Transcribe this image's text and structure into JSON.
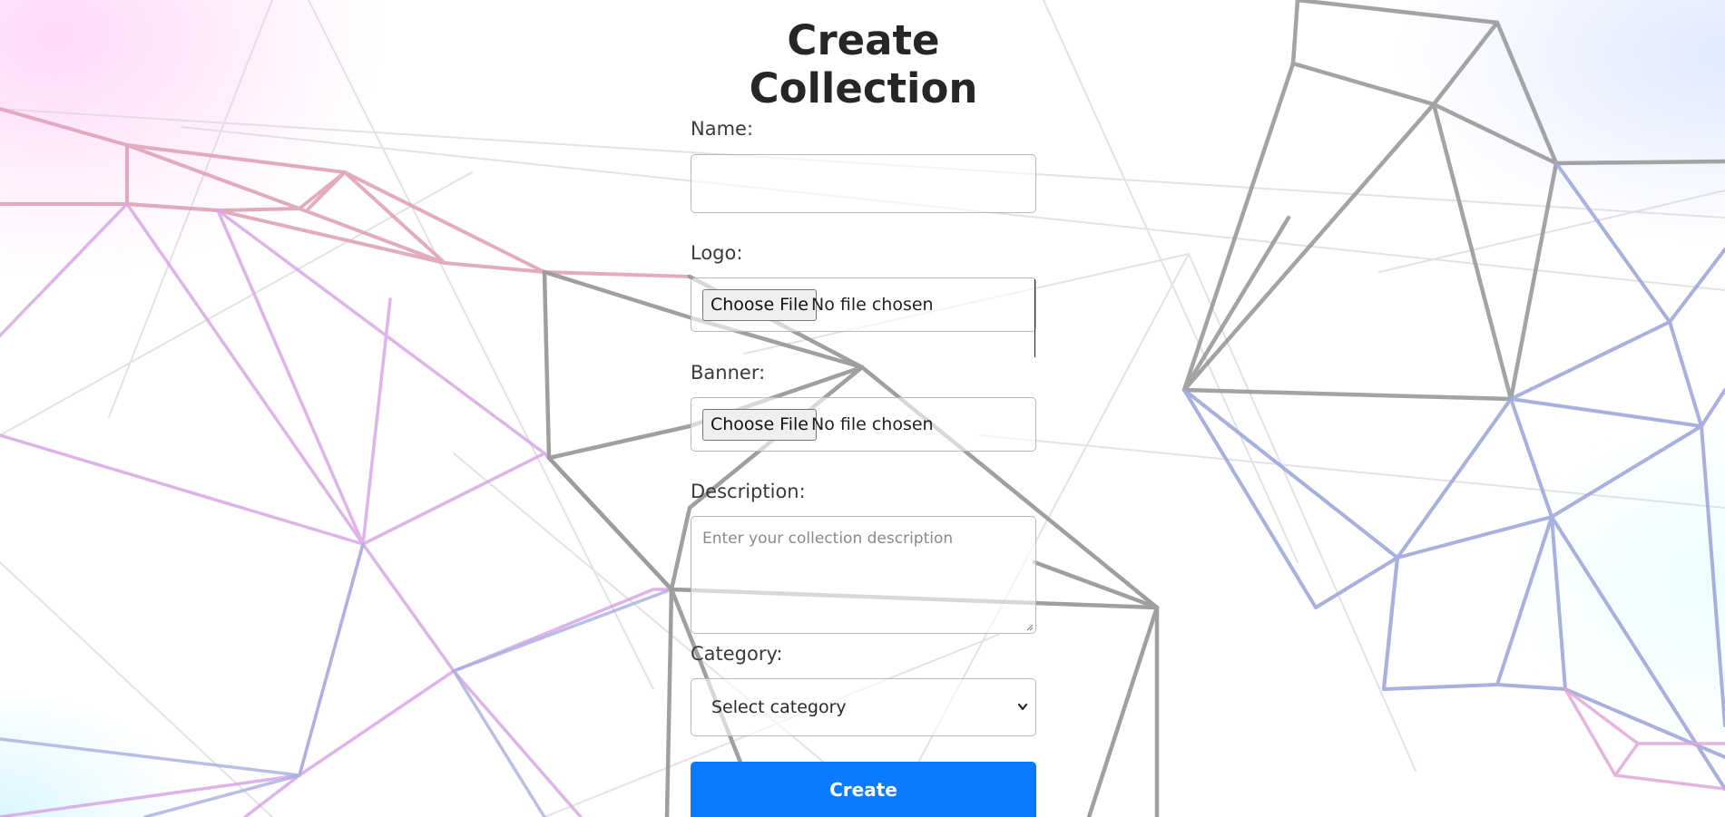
{
  "page": {
    "title": "Create Collection"
  },
  "form": {
    "name": {
      "label": "Name:",
      "value": ""
    },
    "logo": {
      "label": "Logo:",
      "button_label": "Choose File",
      "status": "No file chosen"
    },
    "banner": {
      "label": "Banner:",
      "button_label": "Choose File",
      "status": "No file chosen"
    },
    "description": {
      "label": "Description:",
      "placeholder": "Enter your collection description",
      "value": ""
    },
    "category": {
      "label": "Category:",
      "selected": "Select category"
    },
    "submit_label": "Create"
  },
  "colors": {
    "primary_button": "#0a7bff",
    "title_text": "#262626",
    "input_border": "#b8b8b8"
  },
  "icons": {
    "select_arrow": "chevron-down-icon",
    "background": "polygon-network-illustration"
  }
}
